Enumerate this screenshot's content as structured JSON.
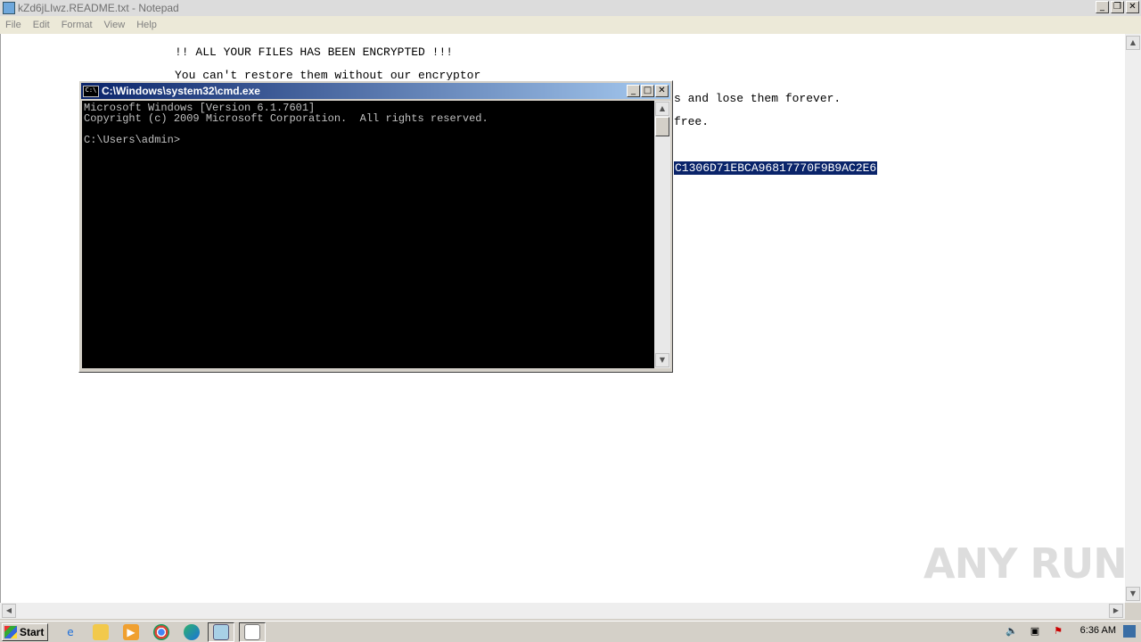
{
  "notepad": {
    "title": "kZd6jLIwz.README.txt - Notepad",
    "menu": [
      "File",
      "Edit",
      "Format",
      "View",
      "Help"
    ],
    "lines": {
      "l1": "!! ALL YOUR FILES HAS BEEN ENCRYPTED !!!",
      "l2": "You can't restore them without our encryptor",
      "l3_visible": "s and lose them forever.",
      "l4_visible": "free.",
      "id_visible": "C1306D71EBCA96817770F9B9AC2E6"
    }
  },
  "cmd": {
    "title": "C:\\Windows\\system32\\cmd.exe",
    "output": "Microsoft Windows [Version 6.1.7601]\nCopyright (c) 2009 Microsoft Corporation.  All rights reserved.\n\nC:\\Users\\admin>"
  },
  "taskbar": {
    "start_label": "Start",
    "clock": "6:36 AM",
    "icons": [
      "ie-icon",
      "explorer-icon",
      "media-player-icon",
      "chrome-icon",
      "edge-icon",
      "notepad-icon",
      "cmd-icon"
    ]
  },
  "watermark": "ANY RUN",
  "colors": {
    "selection": "#0a246a",
    "cmd_title_start": "#0a246a",
    "cmd_title_end": "#a6caf0"
  }
}
